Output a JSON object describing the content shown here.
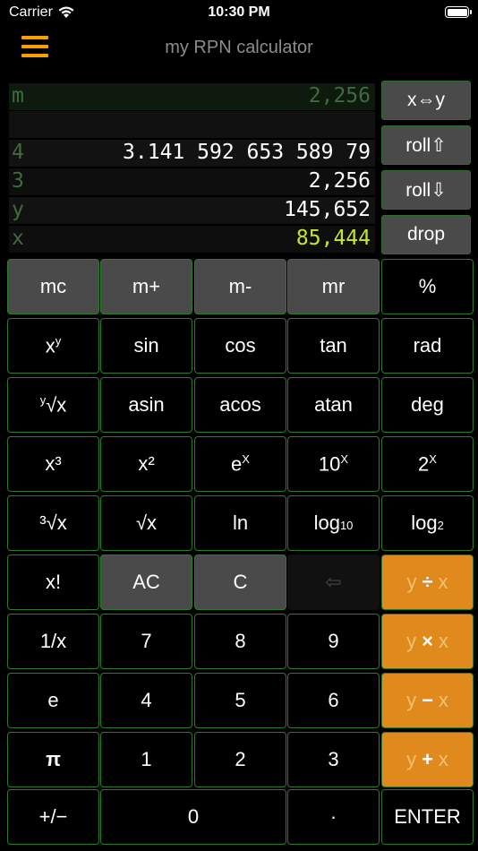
{
  "status": {
    "carrier": "Carrier",
    "time": "10:30 PM",
    "battery_level": 1.0
  },
  "header": {
    "title": "my RPN calculator"
  },
  "stack": [
    {
      "label": "m",
      "value": "2,256",
      "bg": "#0f1a0f",
      "value_color": "#3f6b3f"
    },
    {
      "label": "",
      "value": "",
      "bg": "#111111",
      "value_color": "#ffffff"
    },
    {
      "label": "4",
      "value": "3.141 592 653 589 79",
      "bg": "#121212",
      "value_color": "#ffffff"
    },
    {
      "label": "3",
      "value": "2,256",
      "bg": "#0e0e0e",
      "value_color": "#ffffff"
    },
    {
      "label": "y",
      "value": "145,652",
      "bg": "#121212",
      "value_color": "#ffffff"
    },
    {
      "label": "x",
      "value": "85,444",
      "bg": "#0e0e0e",
      "value_color": "#c5e52a"
    }
  ],
  "side_buttons": [
    "x⇔y",
    "roll⇧",
    "roll⇩",
    "drop"
  ],
  "keys": {
    "row1": [
      "mc",
      "m+",
      "m-",
      "mr",
      "%"
    ],
    "row2": [
      "sin",
      "cos",
      "tan",
      "rad"
    ],
    "row3": [
      "asin",
      "acos",
      "atan",
      "deg"
    ],
    "row4": [
      "x³",
      "x²"
    ],
    "row5": [
      "ln"
    ],
    "row6": [
      "x!",
      "AC",
      "C",
      "⇦"
    ],
    "row7": [
      "1/x",
      "7",
      "8",
      "9"
    ],
    "row8": [
      "e",
      "4",
      "5",
      "6"
    ],
    "row9": [
      "π",
      "1",
      "2",
      "3"
    ],
    "row10": [
      "+/−",
      "0",
      "·",
      "ENTER"
    ],
    "ops": {
      "y": "y",
      "x": "x",
      "div": "÷",
      "mul": "×",
      "sub": "−",
      "add": "+"
    },
    "xy": {
      "x": "x",
      "y": "y"
    },
    "yroot": {
      "y": "y",
      "rad": "√x"
    },
    "cbrt": {
      "three": "³",
      "rad": "√x"
    },
    "sqrt": "√x",
    "ex": {
      "base": "e",
      "exp": "X"
    },
    "tenx": {
      "base": "10",
      "exp": "X"
    },
    "twox": {
      "base": "2",
      "exp": "X"
    },
    "log10": {
      "base": "log",
      "sub": "10"
    },
    "log2": {
      "base": "log",
      "sub": "2"
    }
  },
  "colors": {
    "accent": "#f5a000",
    "key_border": "#2c7a2c",
    "orange_key": "#e08a1e",
    "x_value": "#c5e52a"
  }
}
